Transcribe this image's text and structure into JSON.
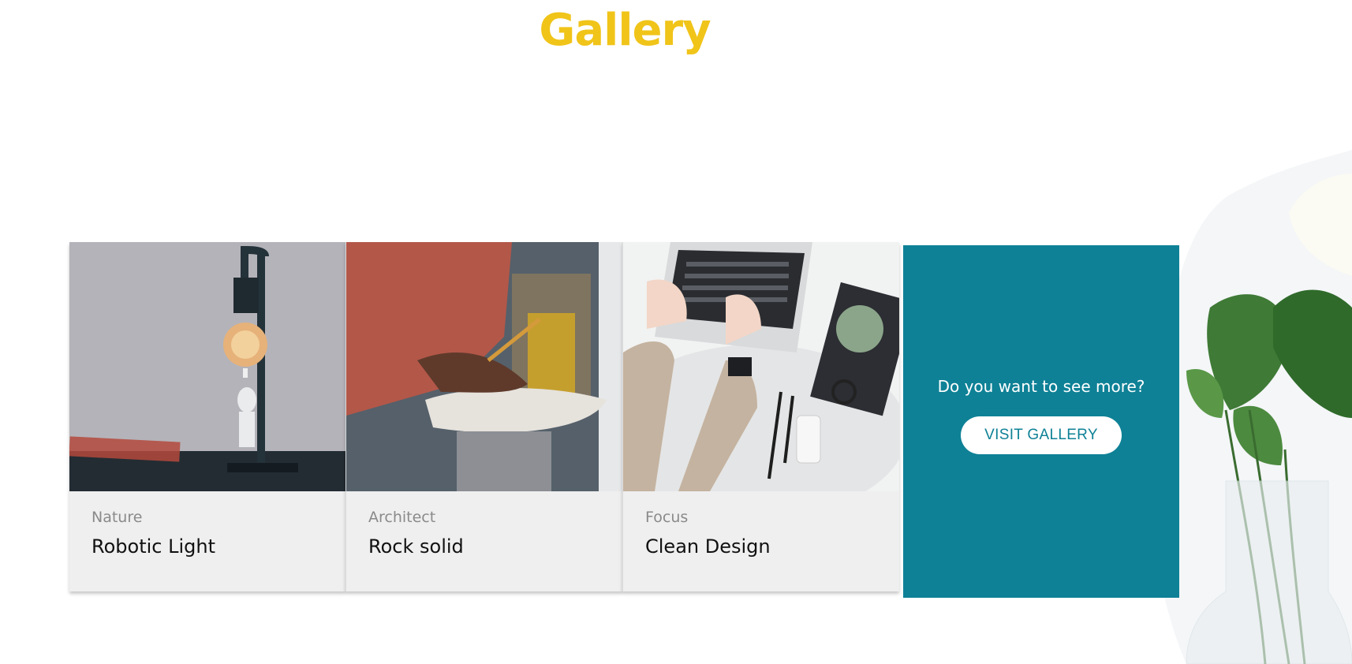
{
  "section": {
    "title": "Gallery"
  },
  "cards": [
    {
      "category": "Nature",
      "title": "Robotic Light",
      "image_icon": "lamp-figurine-photo"
    },
    {
      "category": "Architect",
      "title": "Rock solid",
      "image_icon": "craftsman-pencil-photo"
    },
    {
      "category": "Focus",
      "title": "Clean Design",
      "image_icon": "laptop-desk-photo"
    }
  ],
  "promo": {
    "text": "Do you want to see more?",
    "button_label": "VISIT GALLERY"
  },
  "colors": {
    "title": "#f0c419",
    "promo_bg": "#0e8196",
    "card_bg": "#efefef"
  }
}
